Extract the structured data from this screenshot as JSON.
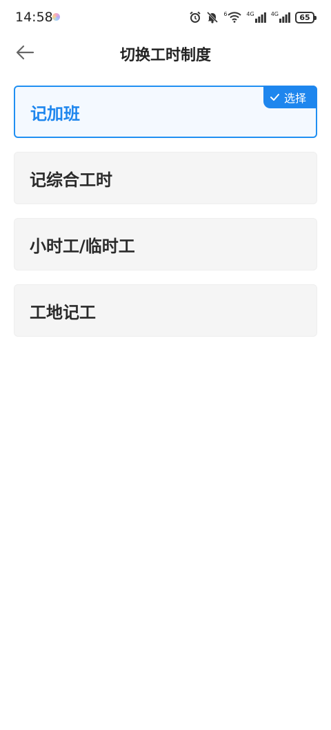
{
  "status_bar": {
    "time": "14:58",
    "wifi_badge": "6",
    "net1": "4G",
    "net2": "4G",
    "battery": "65"
  },
  "header": {
    "title": "切换工时制度"
  },
  "options": [
    {
      "label": "记加班",
      "selected": true,
      "badge": "选择"
    },
    {
      "label": "记综合工时",
      "selected": false
    },
    {
      "label": "小时工/临时工",
      "selected": false
    },
    {
      "label": "工地记工",
      "selected": false
    }
  ],
  "colors": {
    "accent": "#1e86ee",
    "card_bg": "#f5f5f5",
    "selected_bg": "#f4f9ff"
  }
}
